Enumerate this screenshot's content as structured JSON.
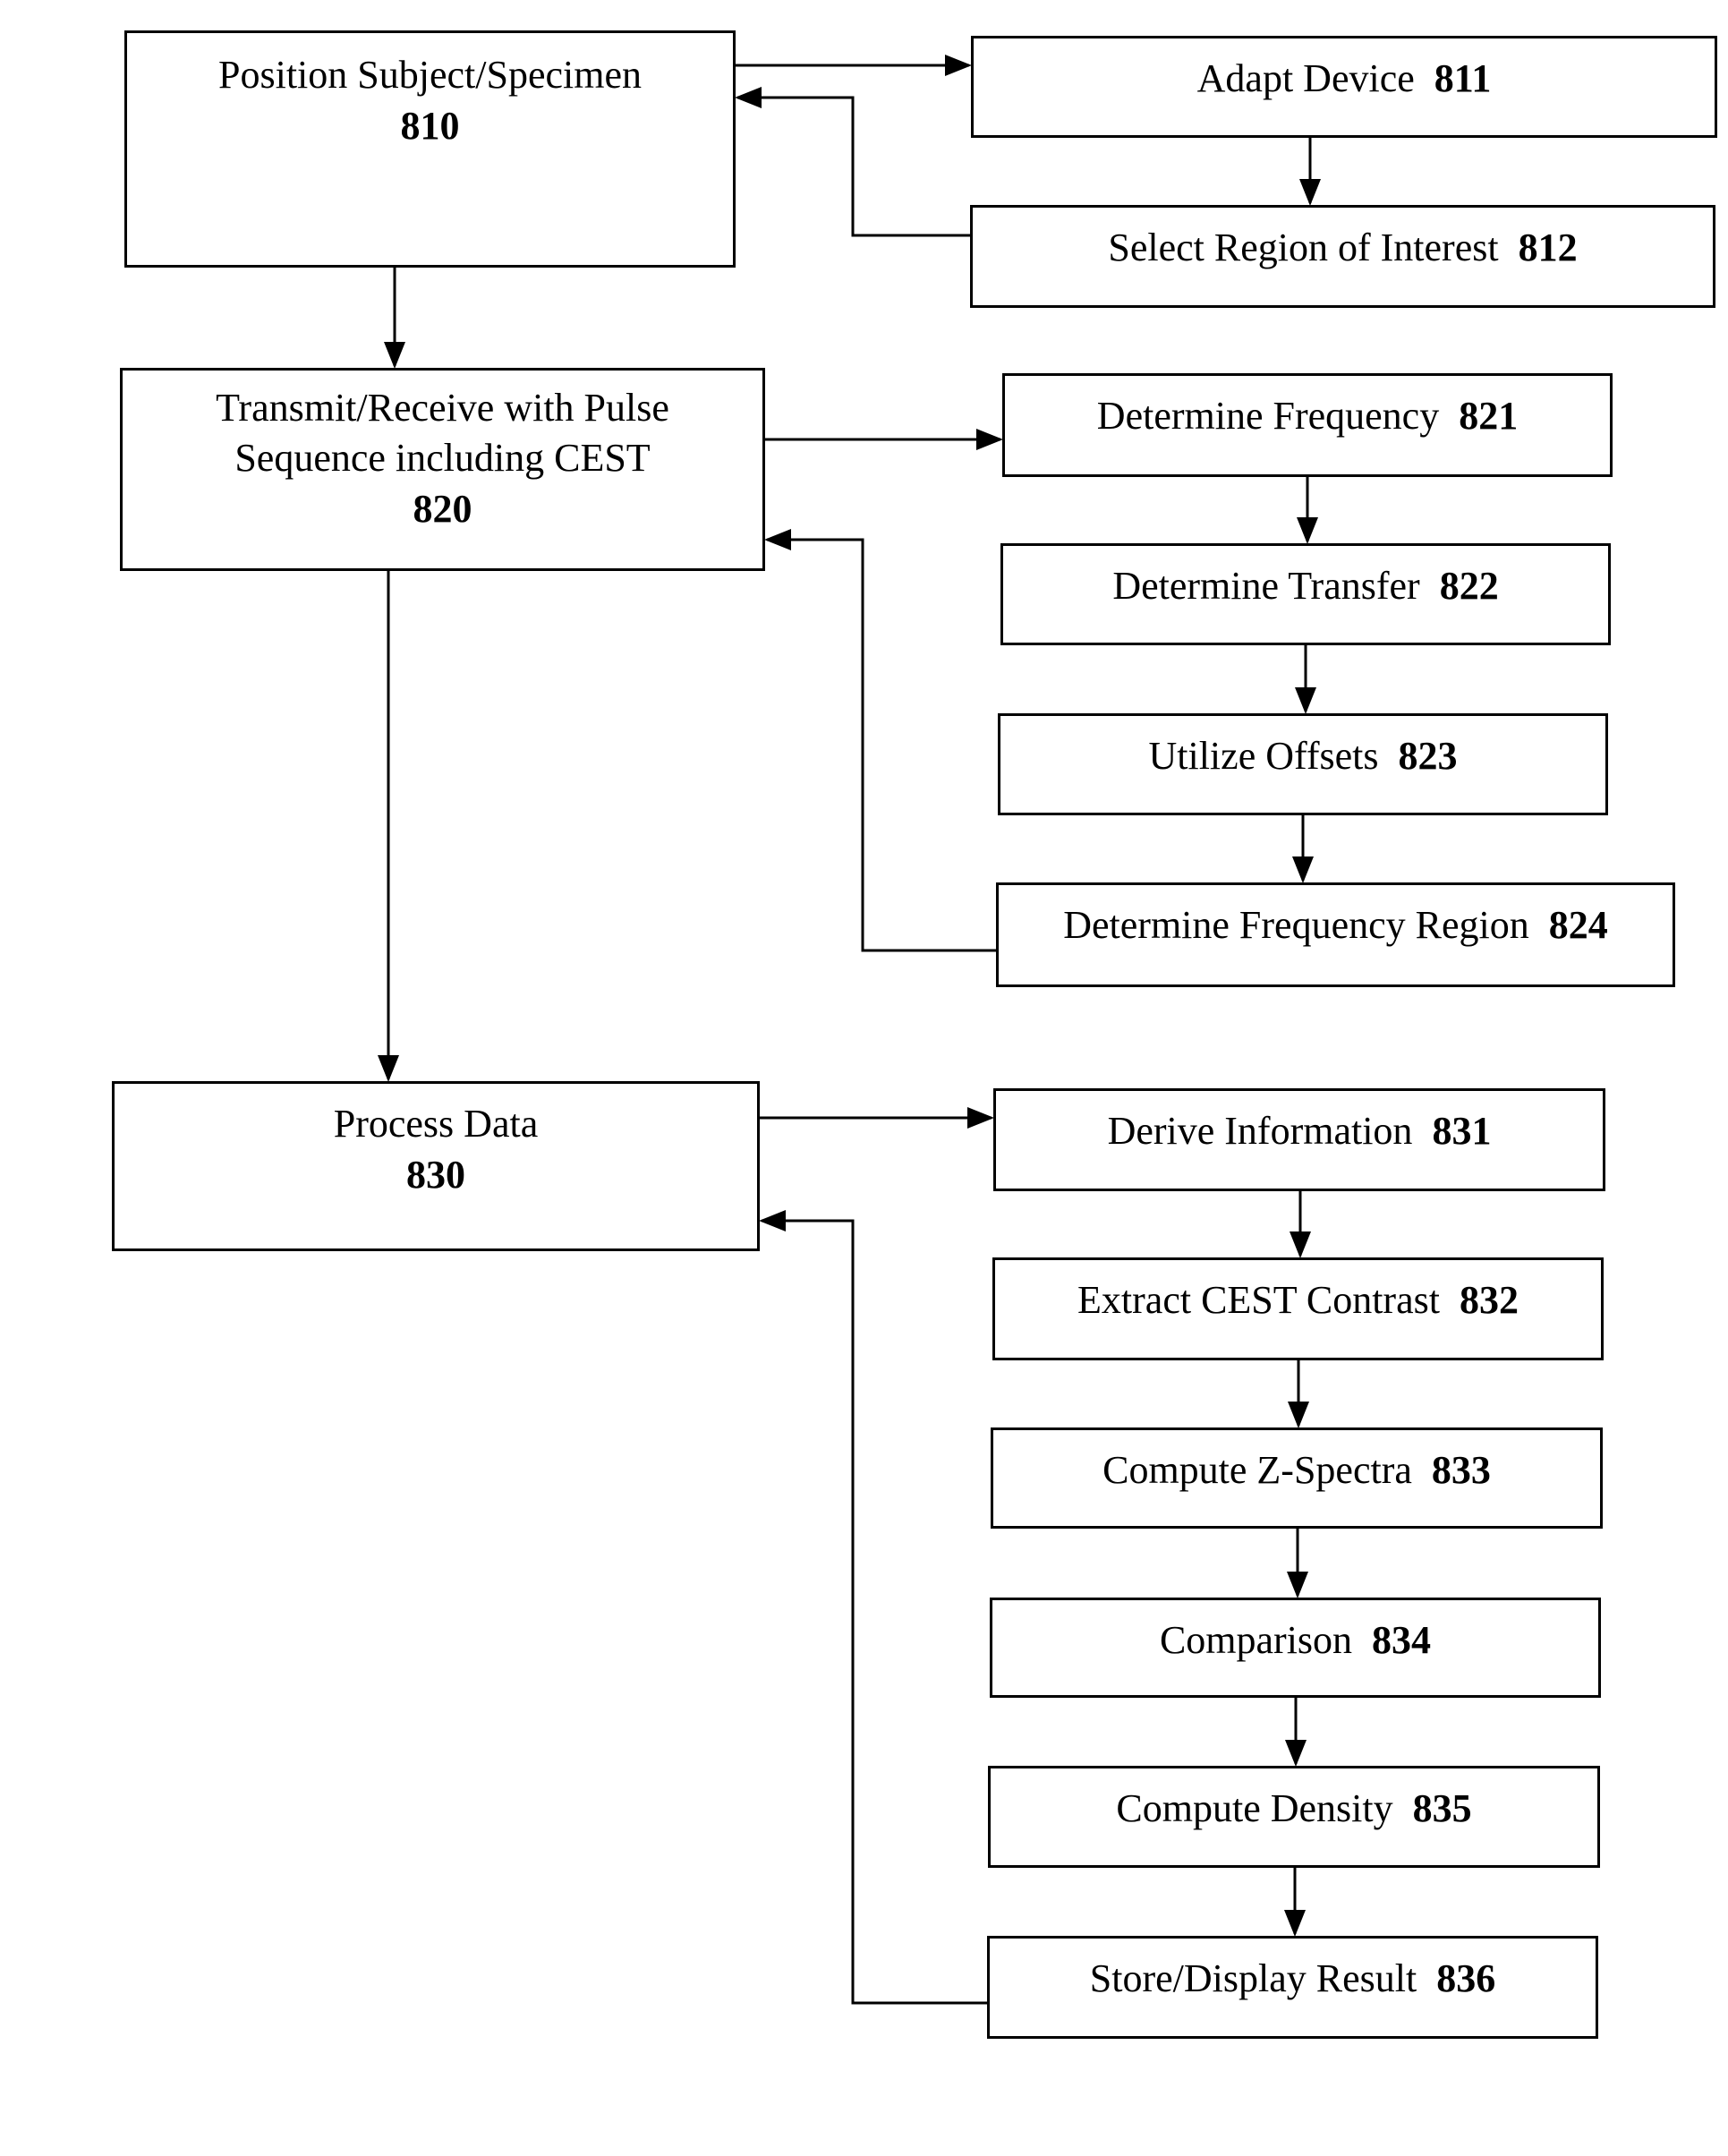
{
  "diagram": {
    "type": "flowchart",
    "stages": [
      {
        "id": "810",
        "text": "Position Subject/Specimen",
        "number": "810",
        "substeps": [
          {
            "id": "811",
            "text": "Adapt Device",
            "number": "811"
          },
          {
            "id": "812",
            "text": "Select Region of Interest",
            "number": "812"
          }
        ]
      },
      {
        "id": "820",
        "text": "Transmit/Receive with Pulse Sequence including CEST",
        "line1": "Transmit/Receive with Pulse",
        "line2": "Sequence including CEST",
        "number": "820",
        "substeps": [
          {
            "id": "821",
            "text": "Determine Frequency",
            "number": "821"
          },
          {
            "id": "822",
            "text": "Determine Transfer",
            "number": "822"
          },
          {
            "id": "823",
            "text": "Utilize Offsets",
            "number": "823"
          },
          {
            "id": "824",
            "text": "Determine Frequency Region",
            "number": "824"
          }
        ]
      },
      {
        "id": "830",
        "text": "Process Data",
        "number": "830",
        "substeps": [
          {
            "id": "831",
            "text": "Derive Information",
            "number": "831"
          },
          {
            "id": "832",
            "text": "Extract CEST Contrast",
            "number": "832"
          },
          {
            "id": "833",
            "text": "Compute Z-Spectra",
            "number": "833"
          },
          {
            "id": "834",
            "text": "Comparison",
            "number": "834"
          },
          {
            "id": "835",
            "text": "Compute Density",
            "number": "835"
          },
          {
            "id": "836",
            "text": "Store/Display Result",
            "number": "836"
          }
        ]
      }
    ],
    "edges": [
      {
        "from": "810",
        "to": "820"
      },
      {
        "from": "820",
        "to": "830"
      },
      {
        "from": "810",
        "to": "811"
      },
      {
        "from": "811",
        "to": "812"
      },
      {
        "from": "812",
        "to": "810"
      },
      {
        "from": "820",
        "to": "821"
      },
      {
        "from": "821",
        "to": "822"
      },
      {
        "from": "822",
        "to": "823"
      },
      {
        "from": "823",
        "to": "824"
      },
      {
        "from": "824",
        "to": "820"
      },
      {
        "from": "830",
        "to": "831"
      },
      {
        "from": "831",
        "to": "832"
      },
      {
        "from": "832",
        "to": "833"
      },
      {
        "from": "833",
        "to": "834"
      },
      {
        "from": "834",
        "to": "835"
      },
      {
        "from": "835",
        "to": "836"
      },
      {
        "from": "836",
        "to": "830"
      }
    ]
  }
}
